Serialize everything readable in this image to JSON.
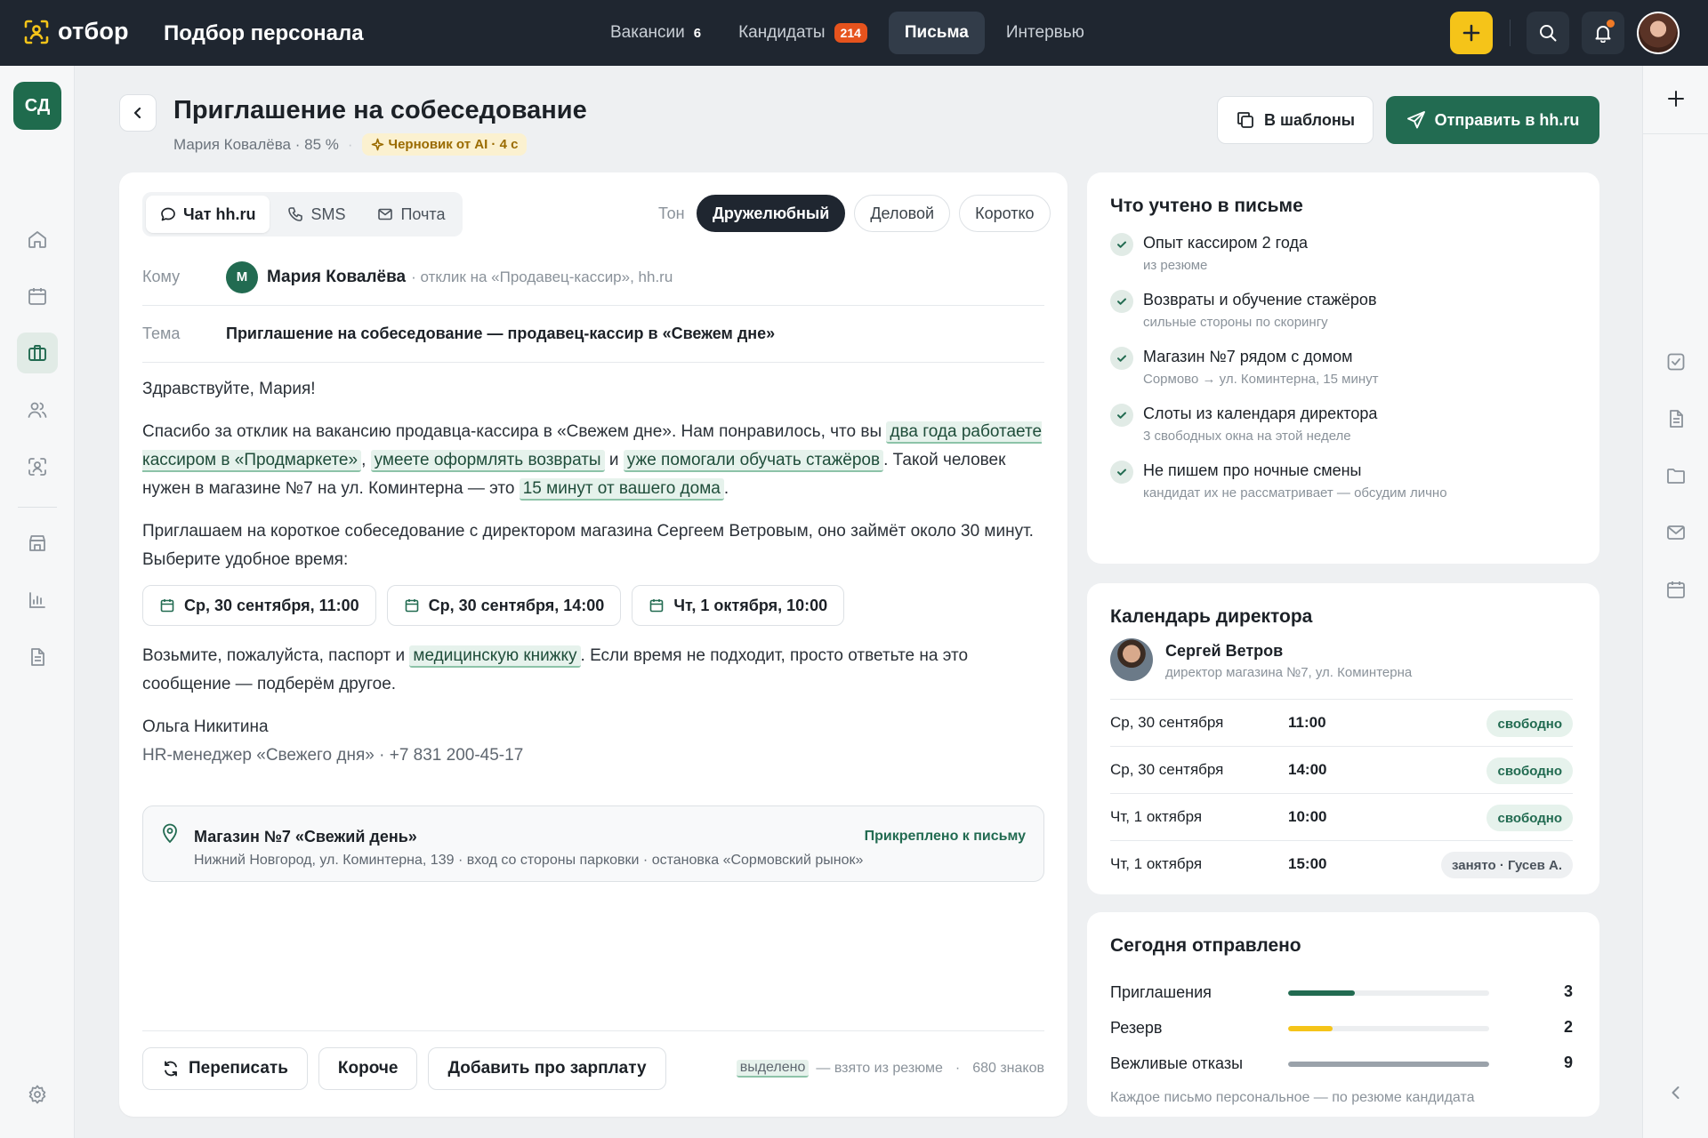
{
  "app": {
    "logo_text": "отбор",
    "title": "Подбор персонала",
    "nav": [
      {
        "label": "Вакансии",
        "count": "6"
      },
      {
        "label": "Кандидаты",
        "count": "214"
      },
      {
        "label": "Письма"
      },
      {
        "label": "Интервью"
      }
    ],
    "org_initials": "СД",
    "icons": {
      "top_right": [
        "plus-icon",
        "search-icon",
        "bell-icon"
      ],
      "left": [
        "home-icon",
        "calendar-icon",
        "briefcase-icon",
        "users-icon",
        "scan-person-icon",
        "store-icon",
        "chart-icon",
        "document-icon",
        "settings-icon"
      ],
      "right": [
        "plus-icon",
        "checkbox-icon",
        "document-icon",
        "folder-icon",
        "mail-icon",
        "calendar-icon",
        "chevron-left-icon"
      ]
    },
    "colors": {
      "brand": "#226b51",
      "accent": "#f5c419",
      "topbar": "#1f2630",
      "badge": "#e6531d"
    }
  },
  "header": {
    "title": "Приглашение на собеседование",
    "subtitle": "Мария Ковалёва · 85 %",
    "ai_chip": "Черновик от AI · 4 с",
    "templates_button": "В шаблоны",
    "send_button": "Отправить в hh.ru"
  },
  "composer": {
    "channels": [
      "Чат hh.ru",
      "SMS",
      "Почта"
    ],
    "tone_label": "Тон",
    "tones": [
      "Дружелюбный",
      "Деловой",
      "Коротко"
    ],
    "to_label": "Кому",
    "to_initial": "М",
    "to_name": "Мария Ковалёва",
    "to_meta": "· отклик на «Продавец-кассир», hh.ru",
    "subject_label": "Тема",
    "subject": "Приглашение на собеседование — продавец-кассир в «Свежем дне»",
    "letter": {
      "greeting": "Здравствуйте, Мария!",
      "p1_a": "Спасибо за отклик на вакансию продавца-кассира в «Свежем дне». Нам понравилось, что вы ",
      "p1_h1": "два года работаете кассиром в «Продмаркете»",
      "p1_b": ", ",
      "p1_h2": "умеете оформлять возвраты",
      "p1_c": " и ",
      "p1_h3": "уже помогали обучать стажёров",
      "p1_d": ". Такой человек нужен в магазине №7 на ул. Коминтерна — это ",
      "p1_h4": "15 минут от вашего дома",
      "p1_e": ".",
      "p2": "Приглашаем на короткое собеседование с директором магазина Сергеем Ветровым, оно займёт около 30 минут. Выберите удобное время:",
      "slots": [
        "Ср, 30 сентября, 11:00",
        "Ср, 30 сентября, 14:00",
        "Чт, 1 октября, 10:00"
      ],
      "p3_a": "Возьмите, пожалуйста, паспорт и ",
      "p3_h": "медицинскую книжку",
      "p3_b": ". Если время не подходит, просто ответьте на это сообщение — подберём другое.",
      "sign_name": "Ольга Никитина",
      "sign_role": "HR-менеджер «Свежего дня» · +7 831 200-45-17"
    },
    "attachment": {
      "title": "Магазин №7 «Свежий день»",
      "address": "Нижний Новгород, ул. Коминтерна, 139 · вход со стороны парковки · остановка «Сормовский рынок»",
      "status": "Прикреплено к письму"
    },
    "actions": [
      "Переписать",
      "Короче",
      "Добавить про зарплату"
    ],
    "legend_chip": "выделено",
    "legend_text": "— взято из резюме",
    "dot": "·",
    "char_count": "680 знаков"
  },
  "considered": {
    "title": "Что учтено в письме",
    "items": [
      {
        "main": "Опыт кассиром 2 года",
        "sub": "из резюме"
      },
      {
        "main": "Возвраты и обучение стажёров",
        "sub": "сильные стороны по скорингу"
      },
      {
        "main": "Магазин №7 рядом с домом",
        "sub": "Сормово → ул. Коминтерна, 15 минут"
      },
      {
        "main": "Слоты из календаря директора",
        "sub": "3 свободных окна на этой неделе"
      },
      {
        "main": "Не пишем про ночные смены",
        "sub": "кандидат их не рассматривает — обсудим лично"
      }
    ]
  },
  "calendar": {
    "title": "Календарь директора",
    "director_name": "Сергей Ветров",
    "director_role": "директор магазина №7, ул. Коминтерна",
    "rows": [
      {
        "day": "Ср, 30 сентября",
        "time": "11:00",
        "status": "свободно",
        "free": true
      },
      {
        "day": "Ср, 30 сентября",
        "time": "14:00",
        "status": "свободно",
        "free": true
      },
      {
        "day": "Чт, 1 октября",
        "time": "10:00",
        "status": "свободно",
        "free": true
      },
      {
        "day": "Чт, 1 октября",
        "time": "15:00",
        "status": "занято · Гусев А.",
        "free": false
      }
    ]
  },
  "sent_today": {
    "title": "Сегодня отправлено",
    "rows": [
      {
        "label": "Приглашения",
        "value": "3",
        "fill": 0.33,
        "color": "#226b51"
      },
      {
        "label": "Резерв",
        "value": "2",
        "fill": 0.22,
        "color": "#f5c419"
      },
      {
        "label": "Вежливые отказы",
        "value": "9",
        "fill": 1.0,
        "color": "#9aa2aa"
      }
    ],
    "note": "Каждое письмо персональное — по резюме кандидата"
  }
}
